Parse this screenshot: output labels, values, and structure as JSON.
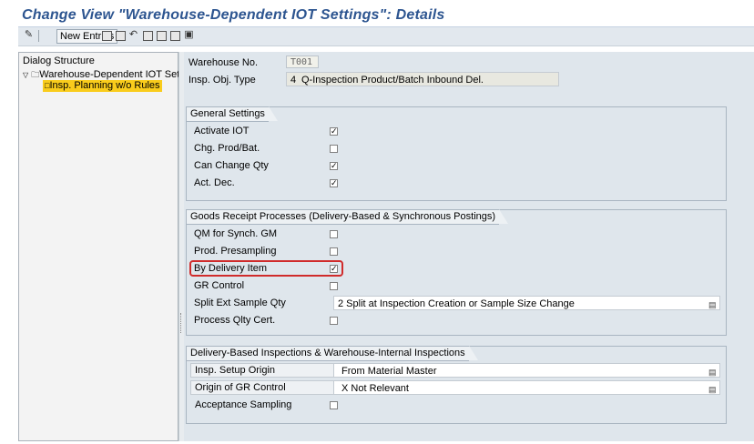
{
  "window": {
    "title": "Change View \"Warehouse-Dependent IOT Settings\": Details"
  },
  "toolbar": {
    "new_entries_label": "New Entries",
    "icons": [
      "display-change-icon",
      "copy-icon",
      "delete-icon",
      "undo-icon",
      "select-all-icon",
      "select-block-icon",
      "deselect-icon",
      "print-icon"
    ]
  },
  "dialog_structure": {
    "title": "Dialog Structure",
    "root_label": "Warehouse-Dependent IOT Set",
    "child_label": "Insp. Planning w/o Rules"
  },
  "header": {
    "warehouse_label": "Warehouse No.",
    "warehouse_value": "T001",
    "insp_obj_label": "Insp. Obj. Type",
    "insp_obj_code": "4",
    "insp_obj_text": "Q-Inspection Product/Batch Inbound Del."
  },
  "general_settings": {
    "title": "General Settings",
    "rows": [
      {
        "label": "Activate IOT",
        "checked": true
      },
      {
        "label": "Chg. Prod/Bat.",
        "checked": false
      },
      {
        "label": "Can Change Qty",
        "checked": true
      },
      {
        "label": "Act. Dec.",
        "checked": true
      }
    ]
  },
  "goods_receipt": {
    "title": "Goods Receipt Processes (Delivery-Based & Synchronous Postings)",
    "rows": [
      {
        "label": "QM for Synch. GM",
        "checked": false
      },
      {
        "label": "Prod. Presampling",
        "checked": false
      },
      {
        "label": "By Delivery Item",
        "checked": true
      },
      {
        "label": "GR Control",
        "checked": false
      }
    ],
    "split_label": "Split Ext Sample Qty",
    "split_value": "2 Split at Inspection Creation or Sample Size Change",
    "process_label": "Process Qlty Cert.",
    "process_checked": false
  },
  "delivery_based": {
    "title": "Delivery-Based Inspections & Warehouse-Internal Inspections",
    "setup_label": "Insp. Setup Origin",
    "setup_value": "From Material Master",
    "gr_origin_label": "Origin of GR Control",
    "gr_origin_value": "X Not Relevant",
    "acceptance_label": "Acceptance Sampling",
    "acceptance_checked": false
  },
  "colors": {
    "title_blue": "#2d5590",
    "tree_highlight": "#f9cc1c",
    "annotation_red": "#d02b2b",
    "panel_bg": "#dfe6ec"
  }
}
